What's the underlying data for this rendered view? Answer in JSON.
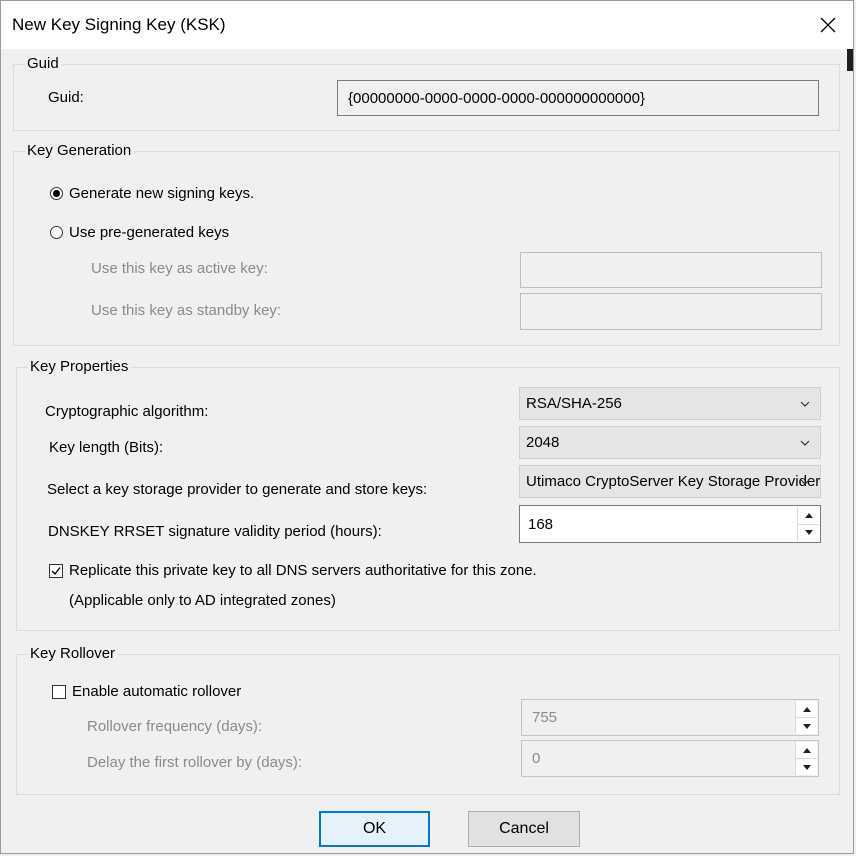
{
  "window": {
    "title": "New Key Signing Key (KSK)"
  },
  "guid_group": {
    "legend": "Guid",
    "label": "Guid:",
    "value": "{00000000-0000-0000-0000-000000000000}"
  },
  "key_generation": {
    "legend": "Key Generation",
    "option_new": "Generate new signing keys.",
    "option_pregenerated": "Use pre-generated keys",
    "active_key_label": "Use this key as active key:",
    "active_key_value": "",
    "standby_key_label": "Use this key as standby key:",
    "standby_key_value": ""
  },
  "key_properties": {
    "legend": "Key Properties",
    "algorithm_label": "Cryptographic algorithm:",
    "algorithm_value": "RSA/SHA-256",
    "key_length_label": "Key length (Bits):",
    "key_length_value": "2048",
    "storage_label": "Select a key storage provider to generate and store keys:",
    "storage_value": "Utimaco CryptoServer Key Storage Provider",
    "validity_label": "DNSKEY RRSET signature validity period (hours):",
    "validity_value": "168",
    "replicate_label": "Replicate this private key to all DNS servers authoritative for this zone.",
    "replicate_note": "(Applicable only to AD integrated zones)"
  },
  "key_rollover": {
    "legend": "Key Rollover",
    "auto_label": "Enable automatic rollover",
    "frequency_label": "Rollover frequency (days):",
    "frequency_value": "755",
    "delay_label": "Delay the first rollover by (days):",
    "delay_value": "0"
  },
  "buttons": {
    "ok": "OK",
    "cancel": "Cancel"
  }
}
